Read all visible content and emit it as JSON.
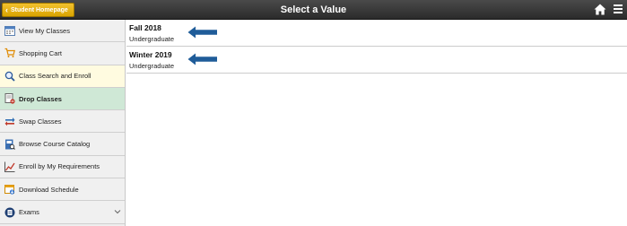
{
  "header": {
    "home_button_label": "Student Homepage",
    "title": "Select a Value",
    "icons": [
      "home-icon",
      "hamburger-menu-icon"
    ]
  },
  "sidebar": {
    "items": [
      {
        "label": "View My Classes",
        "icon": "calendar-icon"
      },
      {
        "label": "Shopping Cart",
        "icon": "cart-icon"
      },
      {
        "label": "Class Search and Enroll",
        "icon": "search-icon"
      },
      {
        "label": "Drop Classes",
        "icon": "drop-classes-icon"
      },
      {
        "label": "Swap Classes",
        "icon": "swap-icon"
      },
      {
        "label": "Browse Course Catalog",
        "icon": "catalog-icon"
      },
      {
        "label": "Enroll by My Requirements",
        "icon": "chart-icon"
      },
      {
        "label": "Download Schedule",
        "icon": "download-calendar-icon"
      },
      {
        "label": "Exams",
        "icon": "exams-icon"
      }
    ],
    "active_item": "Drop Classes"
  },
  "terms": [
    {
      "name": "Fall 2018",
      "career": "Undergraduate"
    },
    {
      "name": "Winter 2019",
      "career": "Undergraduate"
    }
  ],
  "colors": {
    "header_bg": "#333333",
    "home_button": "#e4b010",
    "active_item_bg": "#cfe8d6",
    "search_item_bg": "#fffbe0",
    "arrow": "#1f5c99"
  }
}
